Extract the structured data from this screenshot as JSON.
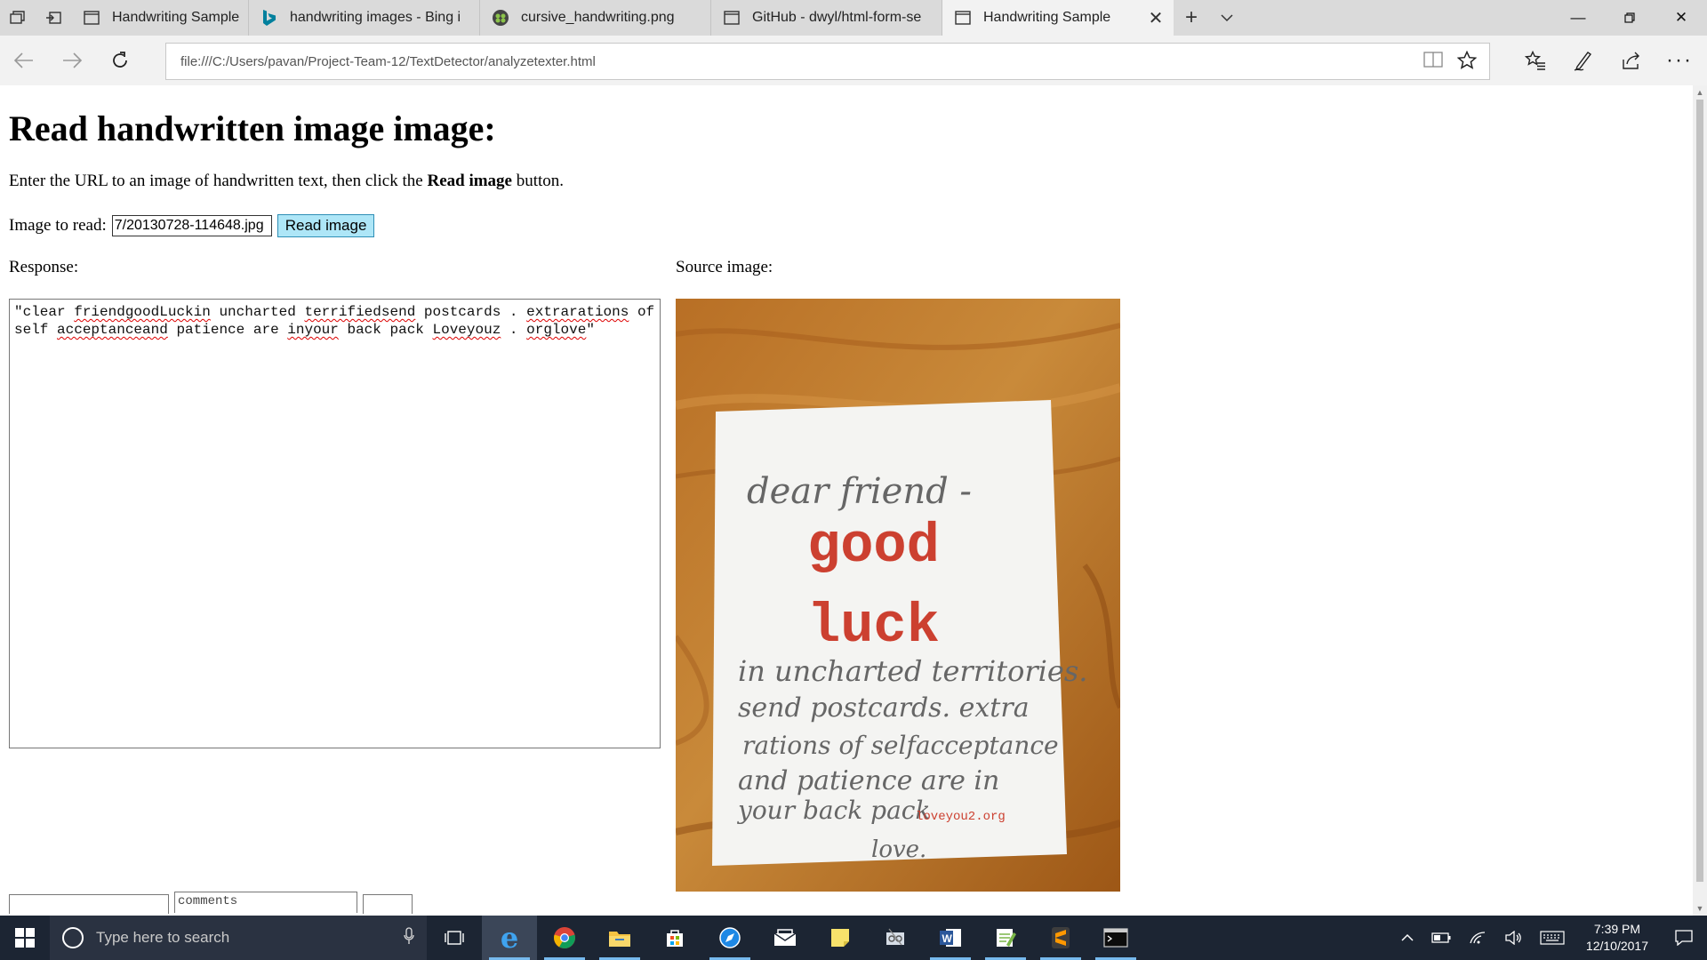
{
  "browser": {
    "tabs": [
      {
        "title": "Handwriting Sample",
        "icon": "page-icon",
        "active": false
      },
      {
        "title": "handwriting images - Bing i",
        "icon": "bing-icon",
        "active": false
      },
      {
        "title": "cursive_handwriting.png",
        "icon": "image-icon",
        "active": false
      },
      {
        "title": "GitHub - dwyl/html-form-se",
        "icon": "page-icon",
        "active": false
      },
      {
        "title": "Handwriting Sample",
        "icon": "page-icon",
        "active": true
      }
    ],
    "address": "file:///C:/Users/pavan/Project-Team-12/TextDetector/analyzetexter.html",
    "accent": "#0078d7"
  },
  "page": {
    "heading": "Read handwritten image image:",
    "intro_before": "Enter the URL to an image of handwritten text, then click the ",
    "intro_bold": "Read image",
    "intro_after": " button.",
    "image_label": "Image to read:",
    "image_url_value": "7/20130728-114648.jpg",
    "read_button": "Read image",
    "response_label": "Response:",
    "source_label": "Source image:",
    "response_tokens": [
      {
        "t": "\"clear ",
        "s": false
      },
      {
        "t": "friendgoodLuckin",
        "s": true
      },
      {
        "t": " uncharted ",
        "s": false
      },
      {
        "t": "terrifiedsend",
        "s": true
      },
      {
        "t": " postcards . ",
        "s": false
      },
      {
        "t": "extrarations",
        "s": true
      },
      {
        "t": " of self ",
        "s": false
      },
      {
        "t": "acceptanceand",
        "s": true
      },
      {
        "t": " patience are ",
        "s": false
      },
      {
        "t": "inyour",
        "s": true
      },
      {
        "t": " back pack ",
        "s": false
      },
      {
        "t": "Loveyouz",
        "s": true
      },
      {
        "t": " . ",
        "s": false
      },
      {
        "t": "orglove",
        "s": true
      },
      {
        "t": "\"",
        "s": false
      }
    ],
    "comments_placeholder": "comments"
  },
  "source_image": {
    "line1": "dear friend -",
    "line2": "good",
    "line3": "luck",
    "line4": "in uncharted territories.",
    "line5": "send postcards. extra",
    "line6": "rations of selfacceptance",
    "line7": "and patience are in",
    "line8": "your back pack",
    "site": "loveyou2.org",
    "line9": "love."
  },
  "taskbar": {
    "search_placeholder": "Type here to search",
    "time": "7:39 PM",
    "date": "12/10/2017"
  }
}
